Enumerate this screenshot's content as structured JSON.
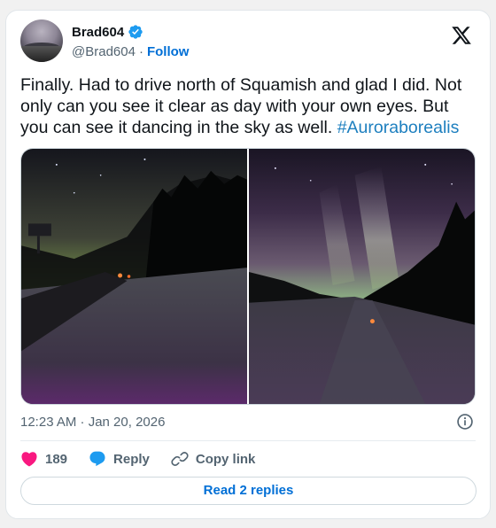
{
  "author": {
    "display_name": "Brad604",
    "handle": "@Brad604",
    "separator": "·",
    "follow_label": "Follow"
  },
  "tweet": {
    "text": "Finally. Had to drive north of Squamish and glad I did. Not only can you see it clear as day with your own eyes. But you can see it dancing in the sky as well. ",
    "hashtag": "#Auroraborealis",
    "timestamp": "12:23 AM · Jan 20, 2026"
  },
  "actions": {
    "like_count": "189",
    "reply_label": "Reply",
    "copy_label": "Copy link"
  },
  "footer": {
    "read_replies_label": "Read 2 replies"
  },
  "colors": {
    "link": "#006fd6",
    "hashtag": "#1d7fbf",
    "like": "#f91880",
    "reply": "#1d9bf0"
  },
  "icons": {
    "verified": "verified-badge-icon",
    "platform": "x-logo-icon",
    "info": "info-icon",
    "like": "heart-icon",
    "reply": "reply-bubble-icon",
    "copy": "link-icon"
  }
}
